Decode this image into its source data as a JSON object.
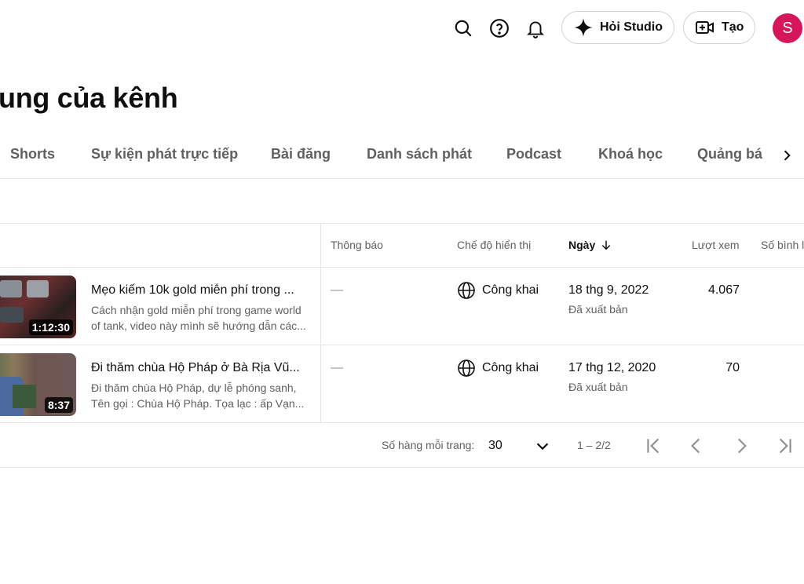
{
  "header": {
    "ask_studio_label": "Hỏi Studio",
    "create_label": "Tạo",
    "avatar_initial": "S",
    "avatar_color": "#d6155a"
  },
  "page": {
    "title": "ung của kênh"
  },
  "tabs": [
    "Shorts",
    "Sự kiện phát trực tiếp",
    "Bài đăng",
    "Danh sách phát",
    "Podcast",
    "Khoá học",
    "Quảng bá"
  ],
  "table": {
    "columns": {
      "notifications": "Thông báo",
      "visibility": "Chế độ hiển thị",
      "date": "Ngày",
      "views": "Lượt xem",
      "comments": "Số bình l"
    },
    "rows": [
      {
        "title": "Mẹo kiếm 10k gold miễn phí trong ...",
        "description": "Cách nhận gold miễn phí trong game world of tank, video này mình sẽ hướng dẫn các...",
        "duration": "1:12:30",
        "notifications": "—",
        "visibility": "Công khai",
        "date": "18 thg 9, 2022",
        "status": "Đã xuất bản",
        "views": "4.067"
      },
      {
        "title": "Đi thăm chùa Hộ Pháp ở Bà Rịa Vũ...",
        "description": "Đi thăm chùa Hộ Pháp, dự lễ phóng sanh, Tên gọi : Chùa Hộ Pháp. Tọa lạc : ấp Vạn...",
        "duration": "8:37",
        "notifications": "—",
        "visibility": "Công khai",
        "date": "17 thg 12, 2020",
        "status": "Đã xuất bản",
        "views": "70"
      }
    ]
  },
  "pagination": {
    "rows_per_page_label": "Số hàng mỗi trang:",
    "rows_per_page": "30",
    "range": "1 – 2/2"
  }
}
